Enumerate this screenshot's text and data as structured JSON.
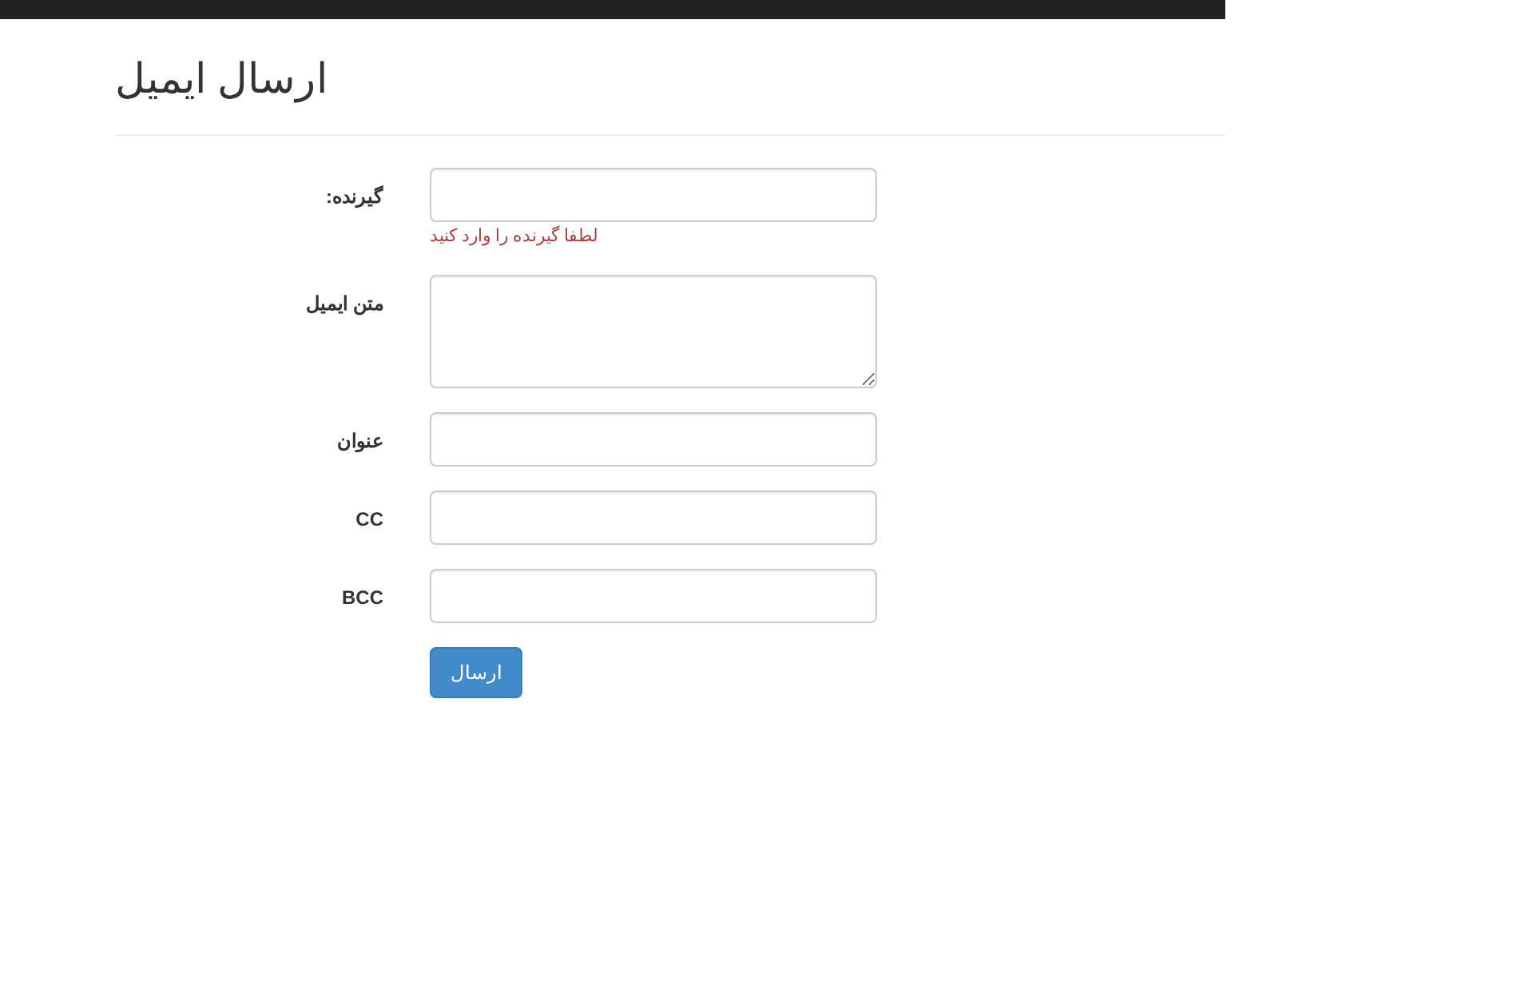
{
  "page": {
    "title": "ارسال ایمیل"
  },
  "fields": [
    {
      "kind": "input",
      "label": ":گیرنده",
      "error": "لطفا گیرنده را وارد کنید"
    },
    {
      "kind": "textarea",
      "label": "متن ایمیل"
    },
    {
      "kind": "input",
      "label": "عنوان"
    },
    {
      "kind": "input",
      "label": "CC"
    },
    {
      "kind": "input",
      "label": "BCC"
    }
  ],
  "submit": {
    "label": "ارسال"
  }
}
